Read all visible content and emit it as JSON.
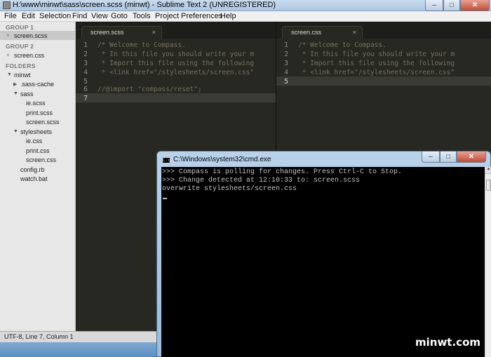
{
  "sublime": {
    "title": "H:\\www\\minwt\\sass\\screen.scss (minwt) - Sublime Text 2 (UNREGISTERED)",
    "menu": [
      "File",
      "Edit",
      "Selection",
      "Find",
      "View",
      "Goto",
      "Tools",
      "Project",
      "Preferences",
      "Help"
    ],
    "sidebar": {
      "group1": "GROUP 1",
      "group1_file": "screen.scss",
      "group2": "GROUP 2",
      "group2_file": "screen.css",
      "folders": "FOLDERS",
      "tree": {
        "root": "minwt",
        "sass_cache": ".sass-cache",
        "sass": "sass",
        "sass_files": [
          "ie.scss",
          "print.scss",
          "screen.scss"
        ],
        "stylesheets": "stylesheets",
        "css_files": [
          "ie.css",
          "print.css",
          "screen.css"
        ],
        "config": "config.rb",
        "watch": "watch.bat"
      }
    },
    "left_pane": {
      "tab": "screen.scss",
      "lines": [
        "/* Welcome to Compass.",
        " * In this file you should write your m",
        " * Import this file using the following",
        " * <link href=\"/stylesheets/screen.css\"",
        "",
        "//@import \"compass/reset\";",
        ""
      ],
      "line_numbers": [
        "1",
        "2",
        "3",
        "4",
        "5",
        "6",
        "7"
      ],
      "active_line": 7
    },
    "right_pane": {
      "tab": "screen.css",
      "lines": [
        "/* Welcome to Compass.",
        " * In this file you should write your m",
        " * Import this file using the following",
        " * <link href=\"/stylesheets/screen.css\"",
        ""
      ],
      "line_numbers": [
        "1",
        "2",
        "3",
        "4",
        "5"
      ],
      "active_line": 5
    },
    "tab_close_glyph": "×",
    "status": "UTF-8, Line 7, Column 1"
  },
  "cmd": {
    "title": "C:\\Windows\\system32\\cmd.exe",
    "lines": [
      ">>> Compass is polling for changes. Press Ctrl-C to Stop.",
      ">>> Change detected at 12:10:33 to: screen.scss",
      "overwrite stylesheets/screen.css"
    ]
  },
  "window_buttons": {
    "min": "–",
    "max": "□",
    "close": "✕"
  },
  "watermark": "minwt.com",
  "colors": {
    "editor_bg": "#272822",
    "comment": "#75715e",
    "sidebar_bg": "#e7e7e7",
    "cmd_bg": "#000000"
  }
}
